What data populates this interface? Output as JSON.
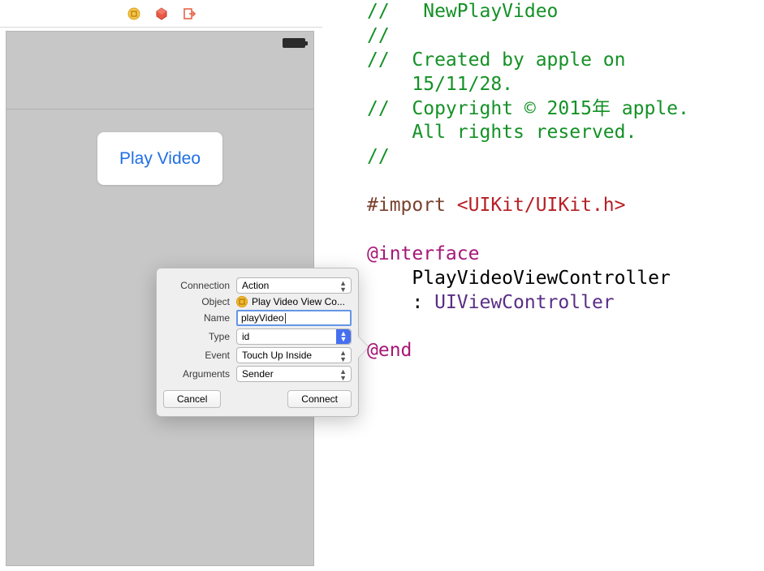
{
  "canvas": {
    "button_label": "Play Video"
  },
  "popover": {
    "labels": {
      "connection": "Connection",
      "object": "Object",
      "name": "Name",
      "type": "Type",
      "event": "Event",
      "arguments": "Arguments"
    },
    "connection_value": "Action",
    "object_value": "Play Video View Co...",
    "name_value": "playVideo",
    "type_value": "id",
    "event_value": "Touch Up Inside",
    "arguments_value": "Sender",
    "cancel_label": "Cancel",
    "connect_label": "Connect"
  },
  "code": {
    "l1": "//   NewPlayVideo",
    "l2": "//",
    "l3": "//  Created by apple on",
    "l4": "    15/11/28.",
    "l5": "//  Copyright © 2015年 apple.",
    "l6": "    All rights reserved.",
    "l7": "//",
    "l8a": "#import ",
    "l8b": "<UIKit/UIKit.h>",
    "l9": "@interface",
    "l10": "    PlayVideoViewController",
    "l11a": "    : ",
    "l11b": "UIViewController",
    "l12": "@end"
  }
}
